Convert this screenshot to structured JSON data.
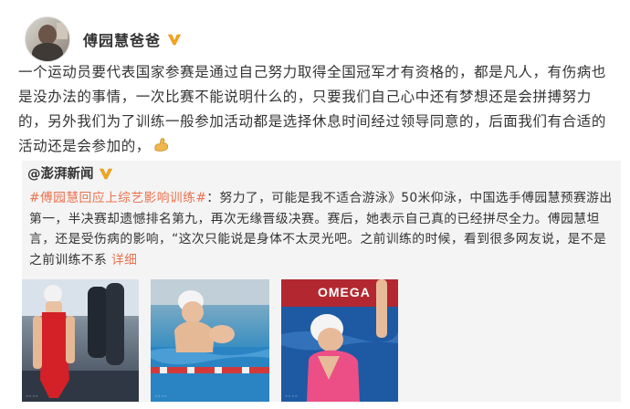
{
  "post": {
    "author_name": "傅园慧爸爸",
    "verified_icon": "verified-v-icon",
    "text": "一个运动员要代表国家参赛是通过自己努力取得全国冠军才有资格的，都是凡人，有伤病也是没办法的事情，一次比赛不能说明什么的，只要我们自己心中还有梦想还是会拼搏努力的，另外我们为了训练一般参加活动都是选择休息时间经过领导同意的，后面我们有合适的活动还是会参加的，",
    "emoji": "muscle-emoji-icon"
  },
  "repost": {
    "author_name": "@澎湃新闻",
    "hashtag": "#傅园慧回应上综艺影响训练#",
    "text": "：努力了，可能是我不适合游泳》50米仰泳，中国选手傅园慧预赛游出第一，半决赛却遗憾排名第九，再次无缘晋级决赛。赛后，她表示自己真的已经拼尽全力。傅园慧坦言，还是受伤病的影响，“这次只能说是身体不太灵光吧。之前训练的时候，看到很多网友说，是不是之前训练不系",
    "more_link": "详细",
    "photos": [
      {
        "alt": "swimmer-in-red-suit-on-pool-deck-photo"
      },
      {
        "alt": "swimmer-resting-on-lane-rope-photo"
      },
      {
        "alt": "swimmer-in-pink-suit-raising-arm-photo"
      }
    ],
    "sponsor_text": "OMEGA"
  }
}
